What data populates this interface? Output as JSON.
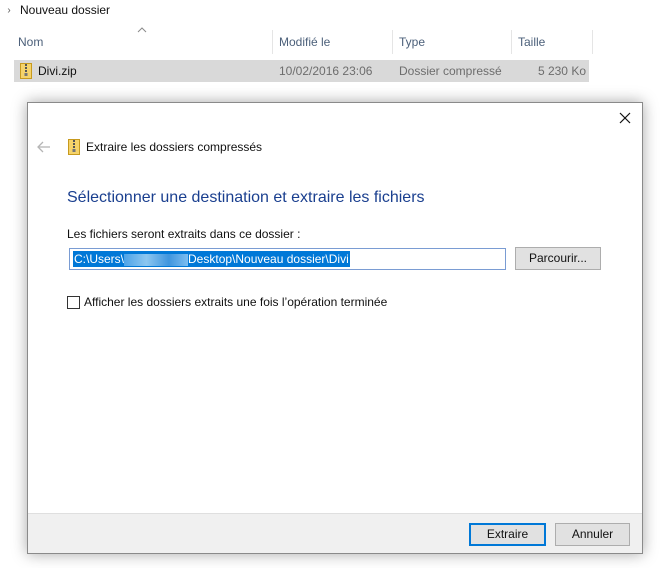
{
  "explorer": {
    "breadcrumb": "Nouveau dossier",
    "columns": {
      "name": "Nom",
      "modified": "Modifié le",
      "type": "Type",
      "size": "Taille"
    },
    "files": [
      {
        "name": "Divi.zip",
        "modified": "10/02/2016 23:06",
        "type": "Dossier compressé",
        "size": "5 230 Ko"
      }
    ]
  },
  "dialog": {
    "title": "Extraire les dossiers compressés",
    "heading": "Sélectionner une destination et extraire les fichiers",
    "dest_label": "Les fichiers seront extraits dans ce dossier :",
    "path_prefix": "C:\\Users\\",
    "path_suffix": "Desktop\\Nouveau dossier\\Divi",
    "browse_label": "Parcourir...",
    "show_checkbox_label": "Afficher les dossiers extraits une fois l’opération terminée",
    "show_checked": false,
    "extract_label": "Extraire",
    "cancel_label": "Annuler"
  },
  "colors": {
    "accent": "#0078d7",
    "heading": "#1a3f8f",
    "selection_row": "#d9d9d9",
    "footer": "#f0f0f0"
  }
}
